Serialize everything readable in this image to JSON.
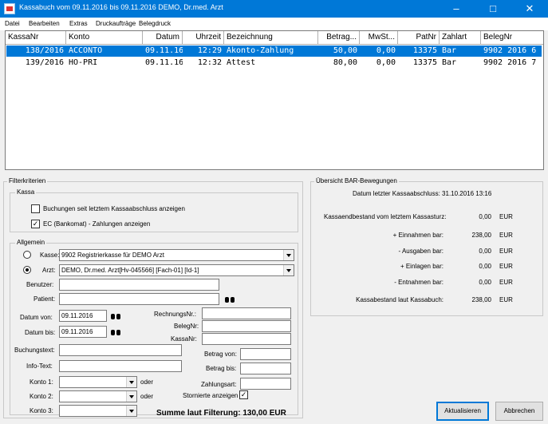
{
  "window": {
    "title": "Kassabuch vom 09.11.2016 bis 09.11.2016 DEMO, Dr.med. Arzt"
  },
  "menu": [
    "Datei",
    "Bearbeiten",
    "Extras",
    "Druckaufträge",
    "Belegdruck"
  ],
  "table": {
    "columns": [
      "KassaNr",
      "Konto",
      "Datum",
      "Uhrzeit",
      "Bezeichnung",
      "Betrag...",
      "MwSt...",
      "PatNr",
      "Zahlart",
      "BelegNr"
    ],
    "rows": [
      [
        "138/2016",
        "ACCONTO",
        "09.11.16",
        "12:29",
        "Akonto-Zahlung",
        "50,00",
        "0,00",
        "13375",
        "Bar",
        "9902 2016 6"
      ],
      [
        "139/2016",
        "HO-PRI",
        "09.11.16",
        "12:32",
        "Attest",
        "80,00",
        "0,00",
        "13375",
        "Bar",
        "9902 2016 7"
      ]
    ],
    "selected_row": 0
  },
  "filter": {
    "title": "Filterkriterien",
    "kassa_group": "Kassa",
    "cb_seit_abschluss": "Buchungen seit letztem Kassaabschluss anzeigen",
    "cb_ec": "EC (Bankomat) - Zahlungen anzeigen",
    "allgemein_group": "Allgemein",
    "kasse_label": "Kasse:",
    "kasse_value": "9902  Registrierkasse für DEMO Arzt",
    "arzt_label": "Arzt:",
    "arzt_value": "DEMO, Dr.med. Arzt[Hv-045566] [Fach-01] [Id-1]",
    "benutzer_label": "Benutzer:",
    "benutzer_value": "",
    "patient_label": "Patient:",
    "patient_value": "",
    "datum_von_label": "Datum von:",
    "datum_von_value": "09.11.2016",
    "datum_bis_label": "Datum bis:",
    "datum_bis_value": "09.11.2016",
    "rechnungsnr_label": "RechnungsNr.:",
    "belegnr_label": "BelegNr:",
    "kassanr_label": "KassaNr:",
    "buchungstext_label": "Buchungstext:",
    "infotext_label": "Info-Text:",
    "betrag_von_label": "Betrag von:",
    "betrag_bis_label": "Betrag bis:",
    "zahlungsart_label": "Zahlungsart:",
    "konto1_label": "Konto 1:",
    "konto2_label": "Konto 2:",
    "konto3_label": "Konto 3:",
    "oder1": "oder",
    "oder2": "oder",
    "stornierte_label": "Stornierte anzeigen",
    "summe": "Summe laut Filterung: 130,00 EUR"
  },
  "overview": {
    "title": "Übersicht BAR-Bewegungen",
    "last_closing": "Datum letzter Kassaabschluss: 31.10.2016 13:16",
    "rows": [
      {
        "label": "Kassaendbestand vom letztem Kassasturz:",
        "value": "0,00",
        "cur": "EUR"
      },
      {
        "label": "+ Einnahmen bar:",
        "value": "238,00",
        "cur": "EUR"
      },
      {
        "label": "- Ausgaben bar:",
        "value": "0,00",
        "cur": "EUR"
      },
      {
        "label": "+ Einlagen bar:",
        "value": "0,00",
        "cur": "EUR"
      },
      {
        "label": "- Entnahmen bar:",
        "value": "0,00",
        "cur": "EUR"
      },
      {
        "label": "Kassabestand laut Kassabuch:",
        "value": "238,00",
        "cur": "EUR"
      }
    ]
  },
  "buttons": {
    "refresh": "Aktualisieren",
    "cancel": "Abbrechen"
  },
  "colors": {
    "titlebar": "#0078d7",
    "selection": "#0078d7"
  }
}
